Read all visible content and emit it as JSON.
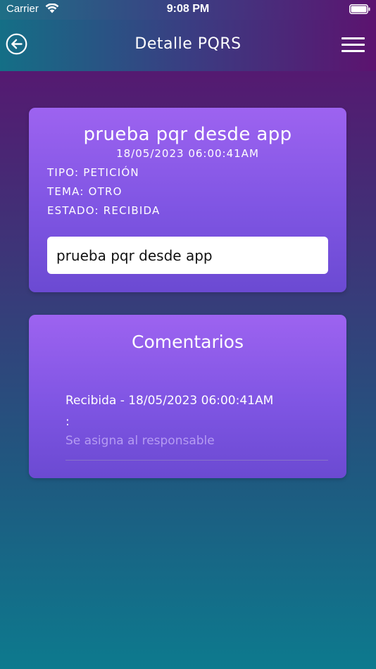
{
  "status_bar": {
    "carrier": "Carrier",
    "time": "9:08 PM"
  },
  "header": {
    "title": "Detalle PQRS",
    "back_icon": "back-arrow-circle-icon",
    "menu_icon": "hamburger-menu-icon"
  },
  "pqr": {
    "title": "prueba pqr desde app",
    "date": "18/05/2023 06:00:41AM",
    "tipo": "TIPO: PETICIÓN",
    "tema": "TEMA: OTRO",
    "estado": "ESTADO: RECIBIDA",
    "description": "prueba pqr desde app"
  },
  "comments": {
    "title": "Comentarios",
    "items": [
      {
        "header": "Recibida - 18/05/2023 06:00:41AM",
        "separator": ":",
        "body": "Se asigna al responsable"
      }
    ]
  },
  "colors": {
    "card_top": "#9d63f0",
    "card_bottom": "#6b4ad2",
    "comment_body": "#b59cf2"
  }
}
